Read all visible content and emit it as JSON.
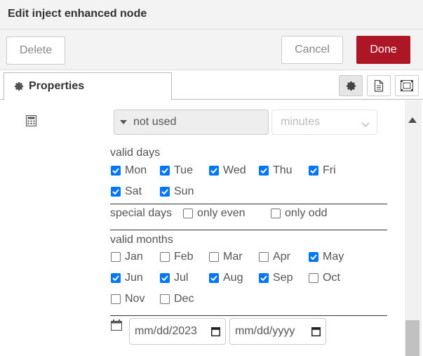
{
  "dialog": {
    "title": "Edit inject enhanced node",
    "delete_label": "Delete",
    "cancel_label": "Cancel",
    "done_label": "Done",
    "done_color": "#ad1625"
  },
  "tabs": {
    "properties_label": "Properties"
  },
  "form": {
    "mode_select_value": "not used",
    "unit_select_value": "minutes",
    "valid_days_label": "valid days",
    "days": [
      {
        "label": "Mon",
        "checked": true
      },
      {
        "label": "Tue",
        "checked": true
      },
      {
        "label": "Wed",
        "checked": true
      },
      {
        "label": "Thu",
        "checked": true
      },
      {
        "label": "Fri",
        "checked": true
      },
      {
        "label": "Sat",
        "checked": true
      },
      {
        "label": "Sun",
        "checked": true
      }
    ],
    "special_days_label": "special days",
    "special_days": [
      {
        "label": "only even",
        "checked": false
      },
      {
        "label": "only odd",
        "checked": false
      }
    ],
    "valid_months_label": "valid months",
    "months": [
      {
        "label": "Jan",
        "checked": false
      },
      {
        "label": "Feb",
        "checked": false
      },
      {
        "label": "Mar",
        "checked": false
      },
      {
        "label": "Apr",
        "checked": false
      },
      {
        "label": "May",
        "checked": true
      },
      {
        "label": "Jun",
        "checked": true
      },
      {
        "label": "Jul",
        "checked": true
      },
      {
        "label": "Aug",
        "checked": true
      },
      {
        "label": "Sep",
        "checked": true
      },
      {
        "label": "Oct",
        "checked": false
      },
      {
        "label": "Nov",
        "checked": false
      },
      {
        "label": "Dec",
        "checked": false
      }
    ],
    "date_start_value": "mm/dd/2023",
    "date_end_value": "mm/dd/yyyy",
    "checkbox_accent": "#0075ff"
  },
  "icons": {
    "field_icon": "calculator-icon",
    "date_icon": "calendar-icon",
    "tab_icons": [
      "gear-icon",
      "document-icon",
      "layout-icon"
    ]
  }
}
